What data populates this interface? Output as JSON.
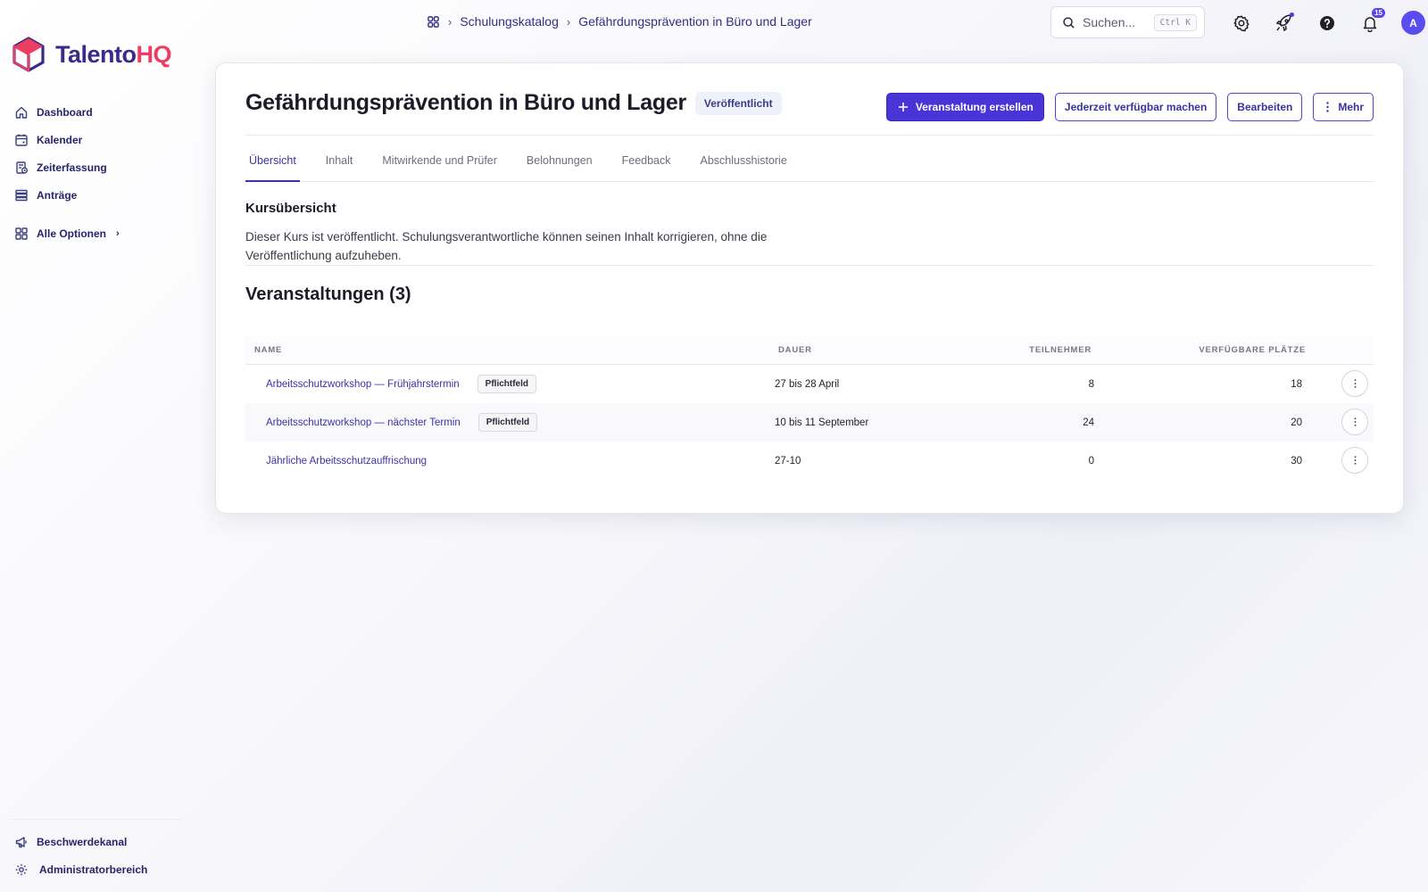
{
  "app": {
    "logo_part1": "Talento",
    "logo_part2": "HQ"
  },
  "sidebar": {
    "items": [
      {
        "label": "Dashboard",
        "icon": "home-icon"
      },
      {
        "label": "Kalender",
        "icon": "calendar-icon"
      },
      {
        "label": "Zeiterfassung",
        "icon": "clock-document-icon"
      },
      {
        "label": "Anträge",
        "icon": "list-icon"
      }
    ],
    "all_options": "Alle Optionen",
    "bottom": [
      {
        "label": "Beschwerdekanal",
        "icon": "megaphone-icon"
      },
      {
        "label": "Administratorbereich",
        "icon": "gear-icon"
      }
    ]
  },
  "breadcrumb": {
    "items": [
      "Schulungskatalog",
      "Gefährdungsprävention in Büro und Lager"
    ]
  },
  "search": {
    "placeholder": "Suchen...",
    "shortcut": "Ctrl K"
  },
  "notifications": {
    "count": "15"
  },
  "user": {
    "initial": "A"
  },
  "course": {
    "title": "Gefährdungsprävention in Büro und Lager",
    "status": "Veröffentlicht",
    "actions": {
      "create_event": "Veranstaltung erstellen",
      "make_available": "Jederzeit verfügbar machen",
      "edit": "Bearbeiten",
      "more": "Mehr"
    },
    "tabs": [
      "Übersicht",
      "Inhalt",
      "Mitwirkende und Prüfer",
      "Belohnungen",
      "Feedback",
      "Abschlusshistorie"
    ],
    "overview_title": "Kursübersicht",
    "overview_text": "Dieser Kurs ist veröffentlicht. Schulungsverantwortliche können seinen Inhalt korrigieren, ohne die Veröffentlichung aufzuheben.",
    "events_title": "Veranstaltungen (3)"
  },
  "events_table": {
    "headers": {
      "name": "NAME",
      "duration": "DAUER",
      "participants": "TEILNEHMER",
      "available": "VERFÜGBARE PLÄTZE"
    },
    "rows": [
      {
        "name": "Arbeitsschutzworkshop — Frühjahrstermin",
        "tag": "Pflichtfeld",
        "duration": "27 bis 28 April",
        "participants": "8",
        "available": "18"
      },
      {
        "name": "Arbeitsschutzworkshop — nächster Termin",
        "tag": "Pflichtfeld",
        "duration": "10 bis 11 September",
        "participants": "24",
        "available": "20"
      },
      {
        "name": "Jährliche Arbeitsschutzauffrischung",
        "tag": "",
        "duration": "27-10",
        "participants": "0",
        "available": "30"
      }
    ]
  },
  "colors": {
    "brand_primary": "#4a34d8",
    "logo_purple": "#3a2a8c",
    "logo_pink": "#ee3d63",
    "link": "#3b33a6"
  }
}
